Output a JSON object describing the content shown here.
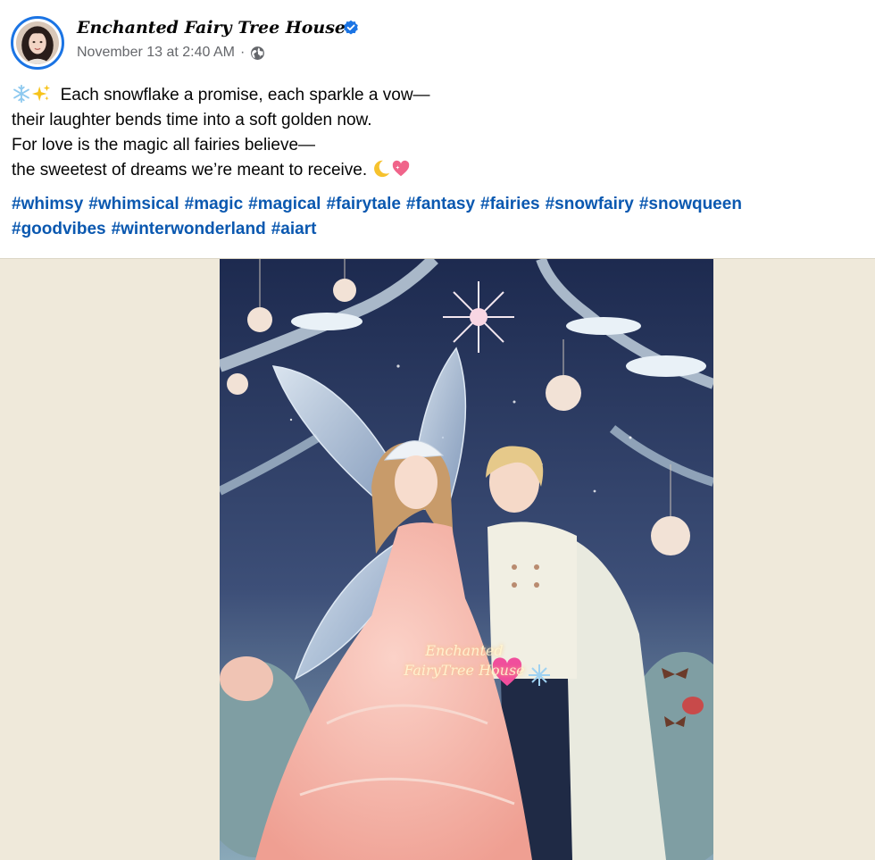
{
  "post": {
    "page_name": "Enchanted Fairy Tree House",
    "timestamp": "November 13 at 2:40 AM",
    "separator": "·",
    "audience_icon": "globe-icon",
    "verified_icon": "verified-badge-icon"
  },
  "caption": {
    "lead_emojis": [
      "snowflake",
      "sparkles"
    ],
    "line1": "Each snowflake a promise, each sparkle a vow—",
    "line2": "their laughter bends time into a soft golden now.",
    "line3": "For love is the magic all fairies believe—",
    "line4": "the sweetest of dreams we’re meant to receive.",
    "trail_emojis": [
      "crescent-moon",
      "sparkling-heart"
    ]
  },
  "hashtags": [
    "#whimsy",
    "#whimsical",
    "#magic",
    "#magical",
    "#fairytale",
    "#fantasy",
    "#fairies",
    "#snowfairy",
    "#snowqueen",
    "#goodvibes",
    "#winterwonderland",
    "#aiart"
  ],
  "image": {
    "watermark_line1": "Enchanted",
    "watermark_line2": "FairyTree House"
  },
  "colors": {
    "link": "#0a58b0",
    "verified": "#1b74e4",
    "meta_text": "#65676b",
    "media_bg": "#efe9da"
  }
}
